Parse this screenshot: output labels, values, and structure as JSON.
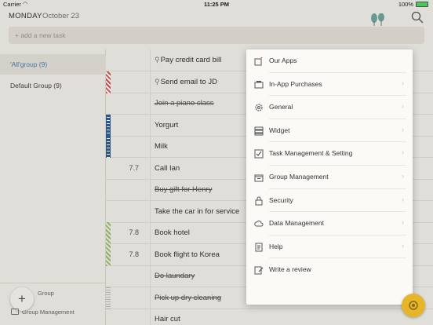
{
  "status_bar": {
    "carrier": "Carrier",
    "time": "11:25 PM",
    "battery": "100%"
  },
  "header": {
    "day": "MONDAY",
    "date": "October 23"
  },
  "add_task": {
    "placeholder": "+ add a new task"
  },
  "sidebar": {
    "groups": [
      {
        "label": "'All'group (9)",
        "active": true
      },
      {
        "label": "Default Group (9)",
        "active": false
      }
    ],
    "new_group_label": "Group",
    "group_management_label": "Group Management"
  },
  "tasks": [
    {
      "num": "",
      "text": "Pay credit card bill",
      "pinned": true,
      "done": false,
      "marker": ""
    },
    {
      "num": "",
      "text": "Send email to JD",
      "pinned": true,
      "done": false,
      "marker": "red"
    },
    {
      "num": "",
      "text": "Join a piano class",
      "pinned": false,
      "done": true,
      "marker": ""
    },
    {
      "num": "",
      "text": "Yorgurt",
      "pinned": false,
      "done": false,
      "marker": "blue"
    },
    {
      "num": "",
      "text": "Milk",
      "pinned": false,
      "done": false,
      "marker": "blue"
    },
    {
      "num": "7.7",
      "text": "Call Ian",
      "pinned": false,
      "done": false,
      "marker": ""
    },
    {
      "num": "",
      "text": "Buy gift for Henry",
      "pinned": false,
      "done": true,
      "marker": ""
    },
    {
      "num": "",
      "text": "Take the car in for service",
      "pinned": false,
      "done": false,
      "marker": ""
    },
    {
      "num": "7.8",
      "text": "Book hotel",
      "pinned": false,
      "done": false,
      "marker": "green"
    },
    {
      "num": "7.8",
      "text": "Book flight to Korea",
      "pinned": false,
      "done": false,
      "marker": "green"
    },
    {
      "num": "",
      "text": "Do laundary",
      "pinned": false,
      "done": true,
      "marker": ""
    },
    {
      "num": "",
      "text": "Pick up dry cleaning",
      "pinned": false,
      "done": true,
      "marker": "gray"
    },
    {
      "num": "",
      "text": "Hair cut",
      "pinned": false,
      "done": false,
      "marker": ""
    }
  ],
  "menu": {
    "items": [
      {
        "label": "Our Apps",
        "icon": "apps-heart-icon",
        "chevron": false
      },
      {
        "label": "In-App Purchases",
        "icon": "purchases-icon",
        "chevron": true
      },
      {
        "label": "General",
        "icon": "gear-icon",
        "chevron": true
      },
      {
        "label": "Widget",
        "icon": "widget-icon",
        "chevron": true
      },
      {
        "label": "Task Management & Setting",
        "icon": "checkbox-icon",
        "chevron": true
      },
      {
        "label": "Group Management",
        "icon": "group-box-icon",
        "chevron": true
      },
      {
        "label": "Security",
        "icon": "lock-icon",
        "chevron": true
      },
      {
        "label": "Data Management",
        "icon": "cloud-icon",
        "chevron": true
      },
      {
        "label": "Help",
        "icon": "help-doc-icon",
        "chevron": true
      },
      {
        "label": "Write a review",
        "icon": "review-edit-icon",
        "chevron": false
      }
    ],
    "chevron_glyph": "›"
  },
  "colors": {
    "accent": "#4a7fb5",
    "fab": "#e5b52a",
    "marker_red": "#d9534f",
    "marker_blue": "#2f5f98",
    "marker_green": "#9bbf6a"
  }
}
